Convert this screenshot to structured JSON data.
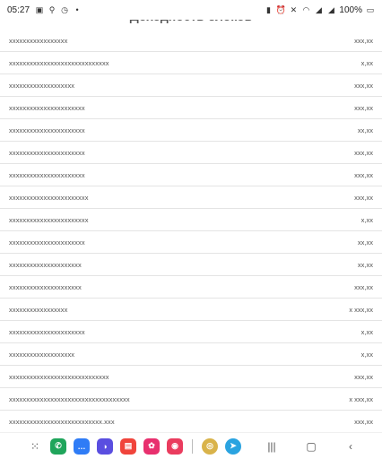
{
  "status_bar": {
    "time": "05:27",
    "battery": "100%"
  },
  "page": {
    "title": "Доходность блоков"
  },
  "rows": [
    {
      "name": "xxxxxxxxxxxxxxxxx",
      "value": "xxx,xx"
    },
    {
      "name": "xxxxxxxxxxxxxxxxxxxxxxxxxxxxx",
      "value": "x,xx"
    },
    {
      "name": "xxxxxxxxxxxxxxxxxxx",
      "value": "xxx,xx"
    },
    {
      "name": "xxxxxxxxxxxxxxxxxxxxxx",
      "value": "xxx,xx"
    },
    {
      "name": "xxxxxxxxxxxxxxxxxxxxxx",
      "value": "xx,xx"
    },
    {
      "name": "xxxxxxxxxxxxxxxxxxxxxx",
      "value": "xxx,xx"
    },
    {
      "name": "xxxxxxxxxxxxxxxxxxxxxx",
      "value": "xxx,xx"
    },
    {
      "name": "xxxxxxxxxxxxxxxxxxxxxxx",
      "value": "xxx,xx"
    },
    {
      "name": "xxxxxxxxxxxxxxxxxxxxxxx",
      "value": "x,xx"
    },
    {
      "name": "xxxxxxxxxxxxxxxxxxxxxx",
      "value": "xx,xx"
    },
    {
      "name": "xxxxxxxxxxxxxxxxxxxxx",
      "value": "xx,xx"
    },
    {
      "name": "xxxxxxxxxxxxxxxxxxxxx",
      "value": "xxx,xx"
    },
    {
      "name": "xxxxxxxxxxxxxxxxx",
      "value": "x xxx,xx"
    },
    {
      "name": "xxxxxxxxxxxxxxxxxxxxxx",
      "value": "x,xx"
    },
    {
      "name": "xxxxxxxxxxxxxxxxxxx",
      "value": "x,xx"
    },
    {
      "name": "xxxxxxxxxxxxxxxxxxxxxxxxxxxxx",
      "value": "xxx,xx"
    },
    {
      "name": "xxxxxxxxxxxxxxxxxxxxxxxxxxxxxxxxxxx",
      "value": "x xxx,xx"
    },
    {
      "name": "xxxxxxxxxxxxxxxxxxxxxxxxxxx.xxx",
      "value": "xxx,xx"
    }
  ],
  "nav": {
    "apps": [
      {
        "icon": "phone-icon",
        "glyph": "✆",
        "color": "#1fa55b"
      },
      {
        "icon": "messages-icon",
        "glyph": "…",
        "color": "#2f7cf6"
      },
      {
        "icon": "internet-icon",
        "glyph": "◑",
        "color": "#5a4ee0"
      },
      {
        "icon": "notes-icon",
        "glyph": "▤",
        "color": "#f0443b"
      },
      {
        "icon": "gallery-icon",
        "glyph": "✿",
        "color": "#e8306e"
      },
      {
        "icon": "camera-icon",
        "glyph": "◉",
        "color": "#ea3c5e"
      },
      {
        "icon": "coin-app-icon",
        "glyph": "◎",
        "color": "#d9b34a"
      },
      {
        "icon": "telegram-icon",
        "glyph": "➤",
        "color": "#2aa3e0"
      }
    ]
  }
}
